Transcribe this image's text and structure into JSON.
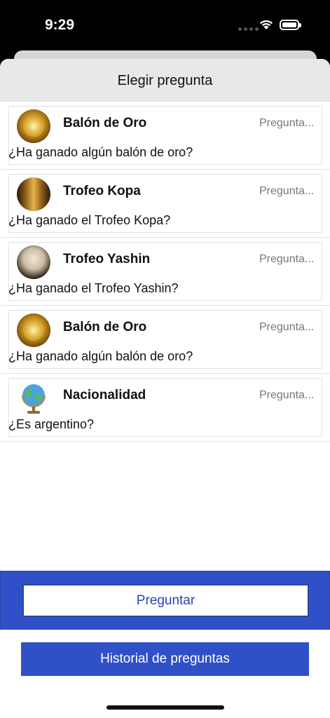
{
  "status_bar": {
    "time": "9:29"
  },
  "sheet": {
    "title": "Elegir pregunta"
  },
  "questions": [
    {
      "title": "Balón de Oro",
      "tag": "Pregunta...",
      "question": "¿Ha ganado algún balón de oro?",
      "icon": "ballon-dor-trophy-image"
    },
    {
      "title": "Trofeo Kopa",
      "tag": "Pregunta...",
      "question": "¿Ha ganado el Trofeo Kopa?",
      "icon": "kopa-trophy-image"
    },
    {
      "title": "Trofeo Yashin",
      "tag": "Pregunta...",
      "question": "¿Ha ganado el Trofeo Yashin?",
      "icon": "yashin-trophy-image"
    },
    {
      "title": "Balón de Oro",
      "tag": "Pregunta...",
      "question": "¿Ha ganado algún balón de oro?",
      "icon": "ballon-dor-trophy-image"
    },
    {
      "title": "Nacionalidad",
      "tag": "Pregunta...",
      "question": "¿Es argentino?",
      "icon": "globe-icon"
    }
  ],
  "buttons": {
    "ask": "Preguntar",
    "history": "Historial de preguntas"
  },
  "colors": {
    "accent": "#3050c8",
    "accent_dark": "#2a44a8"
  }
}
